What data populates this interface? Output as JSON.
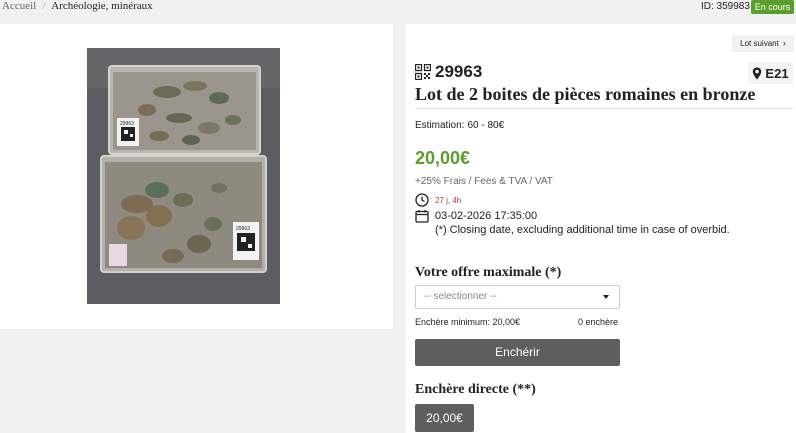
{
  "breadcrumb": {
    "home": "Accueil",
    "separator": "/",
    "current": "Archéologie, minéraux"
  },
  "lot_id_label": "ID: 359983",
  "status_badge": "En cours",
  "next_lot": {
    "label": "Lot suivant",
    "chevron": "›"
  },
  "lot_number": "29963",
  "location": "E21",
  "title": "Lot de 2 boites de pièces romaines en bronze",
  "estimate": {
    "label": "Estimation:",
    "value": "60 - 80€"
  },
  "price": "20,00€",
  "fees": "+25% Frais / Fees & TVA / VAT",
  "time_left": "27 j, 4h",
  "close_date": "03-02-2026 17:35:00",
  "closing_note": "(*) Closing date, excluding additional time in case of overbid.",
  "offer_label": "Votre offre maximale (*)",
  "select_placeholder": "-- selectionner --",
  "min_bid": "Enchère minimum: 20,00€",
  "bid_count": "0 enchère",
  "bid_button": "Enchérir",
  "direct_label": "Enchère directe (**)",
  "direct_button": "20,00€",
  "photo_labels": {
    "top_tag": "29963",
    "bottom_tag": "29963"
  },
  "icons": {
    "qr": "qr-code-icon",
    "location": "map-pin-icon",
    "clock": "clock-icon",
    "calendar": "calendar-icon",
    "caret": "caret-down-icon"
  },
  "colors": {
    "accent_green": "#5a9f2a",
    "button_grey": "#5e5e5e",
    "time_red": "#c0392b"
  }
}
